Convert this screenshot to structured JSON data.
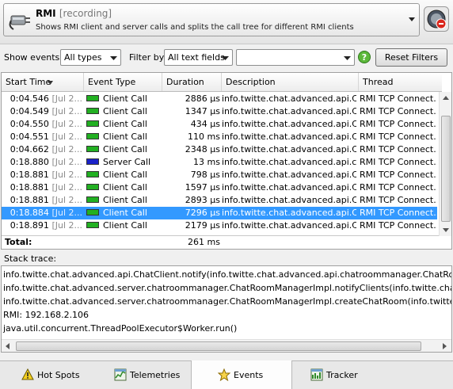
{
  "header": {
    "title": "RMI",
    "status": "[recording]",
    "description": "Shows RMI client and server calls and splits the call tree for different RMI clients"
  },
  "filters": {
    "show_events_label": "Show events:",
    "show_events_value": "All types",
    "filter_by_label": "Filter by",
    "filter_by_value": "All text fields",
    "filter_text_value": "",
    "reset_label": "Reset Filters"
  },
  "table": {
    "columns": [
      "Start Time",
      "Event Type",
      "Duration",
      "Description",
      "Thread"
    ],
    "rows": [
      {
        "time": "0:04.546",
        "date": "[Jul 2...",
        "type": "Client Call",
        "kind": "client",
        "duration": "2886 µs",
        "description": "info.twitte.chat.advanced.api.C...",
        "thread": "RMI TCP Connect..."
      },
      {
        "time": "0:04.549",
        "date": "[Jul 2...",
        "type": "Client Call",
        "kind": "client",
        "duration": "1347 µs",
        "description": "info.twitte.chat.advanced.api.C...",
        "thread": "RMI TCP Connect..."
      },
      {
        "time": "0:04.550",
        "date": "[Jul 2...",
        "type": "Client Call",
        "kind": "client",
        "duration": "434 µs",
        "description": "info.twitte.chat.advanced.api.C...",
        "thread": "RMI TCP Connect..."
      },
      {
        "time": "0:04.551",
        "date": "[Jul 2...",
        "type": "Client Call",
        "kind": "client",
        "duration": "110 ms",
        "description": "info.twitte.chat.advanced.api.C...",
        "thread": "RMI TCP Connect..."
      },
      {
        "time": "0:04.662",
        "date": "[Jul 2...",
        "type": "Client Call",
        "kind": "client",
        "duration": "2348 µs",
        "description": "info.twitte.chat.advanced.api.C...",
        "thread": "RMI TCP Connect..."
      },
      {
        "time": "0:18.880",
        "date": "[Jul 2...",
        "type": "Server Call",
        "kind": "server",
        "duration": "13 ms",
        "description": "info.twitte.chat.advanced.api.ch...",
        "thread": "RMI TCP Connect..."
      },
      {
        "time": "0:18.881",
        "date": "[Jul 2...",
        "type": "Client Call",
        "kind": "client",
        "duration": "798 µs",
        "description": "info.twitte.chat.advanced.api.C...",
        "thread": "RMI TCP Connect..."
      },
      {
        "time": "0:18.881",
        "date": "[Jul 2...",
        "type": "Client Call",
        "kind": "client",
        "duration": "1597 µs",
        "description": "info.twitte.chat.advanced.api.C...",
        "thread": "RMI TCP Connect..."
      },
      {
        "time": "0:18.881",
        "date": "[Jul 2...",
        "type": "Client Call",
        "kind": "client",
        "duration": "2893 µs",
        "description": "info.twitte.chat.advanced.api.C...",
        "thread": "RMI TCP Connect..."
      },
      {
        "time": "0:18.884",
        "date": "[Jul 2...",
        "type": "Client Call",
        "kind": "client",
        "duration": "7296 µs",
        "description": "info.twitte.chat.advanced.api.C...",
        "thread": "RMI TCP Connect...",
        "selected": true
      },
      {
        "time": "0:18.891",
        "date": "[Jul 2...",
        "type": "Client Call",
        "kind": "client",
        "duration": "2179 µs",
        "description": "info.twitte.chat.advanced.api.C...",
        "thread": "RMI TCP Connect..."
      }
    ],
    "total_label": "Total:",
    "total_value": "261 ms"
  },
  "colors": {
    "client": "#22b022",
    "server": "#1a22c8",
    "selection": "#3399ff"
  },
  "stack": {
    "label": "Stack trace:",
    "lines": [
      "info.twitte.chat.advanced.api.ChatClient.notify(info.twitte.chat.advanced.api.chatroommanager.ChatRoomManager,",
      "info.twitte.chat.advanced.server.chatroommanager.ChatRoomManagerImpl.notifyClients(info.twitte.chat.advanced.a",
      "info.twitte.chat.advanced.server.chatroommanager.ChatRoomManagerImpl.createChatRoom(info.twitte.chat.advanc",
      "RMI: 192.168.2.106",
      "java.util.concurrent.ThreadPoolExecutor$Worker.run()"
    ]
  },
  "tabs": [
    {
      "label": "Hot Spots",
      "icon": "warning-icon"
    },
    {
      "label": "Telemetries",
      "icon": "telemetries-icon"
    },
    {
      "label": "Events",
      "icon": "star-icon",
      "active": true
    },
    {
      "label": "Tracker",
      "icon": "tracker-icon"
    }
  ]
}
